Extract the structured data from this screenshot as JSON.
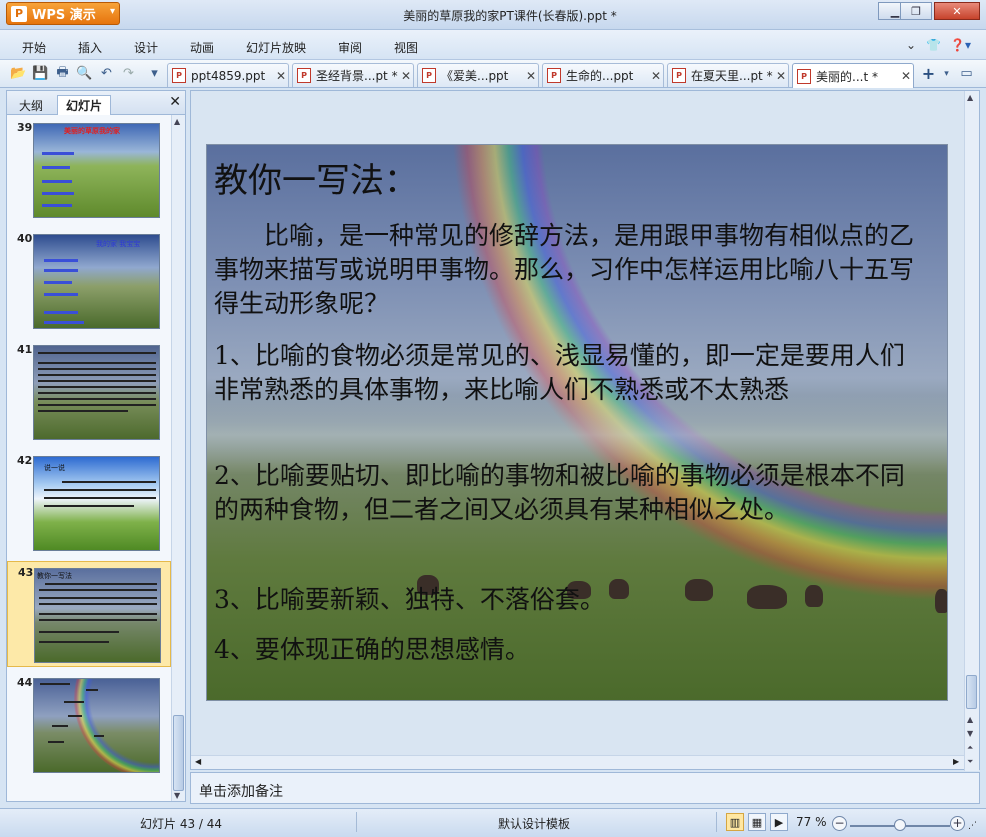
{
  "app": {
    "badge": "WPS 演示",
    "logo_letter": "P",
    "window_title": "美丽的草原我的家PT课件(长春版).ppt *"
  },
  "menu": {
    "items": [
      "开始",
      "插入",
      "设计",
      "动画",
      "幻灯片放映",
      "审阅",
      "视图"
    ]
  },
  "tabs": [
    {
      "label": "ppt4859.ppt",
      "active": false
    },
    {
      "label": "圣经背景...pt *",
      "active": false
    },
    {
      "label": "《爱美...ppt",
      "active": false
    },
    {
      "label": "生命的...ppt",
      "active": false
    },
    {
      "label": "在夏天里...pt *",
      "active": false
    },
    {
      "label": "美丽的...t *",
      "active": true
    }
  ],
  "left_panel": {
    "tab_outline": "大纲",
    "tab_slides": "幻灯片",
    "thumbnails": [
      {
        "num": "39",
        "title": "美丽的草原我的家"
      },
      {
        "num": "40",
        "title": "我的家 我宝宝"
      },
      {
        "num": "41",
        "title": ""
      },
      {
        "num": "42",
        "title": "说一说"
      },
      {
        "num": "43",
        "title": "教你一写法"
      },
      {
        "num": "44",
        "title": ""
      }
    ],
    "selected_index": 4
  },
  "slide": {
    "title": "教你一写法：",
    "intro": "　　比喻，是一种常见的修辞方法，是用跟甲事物有相似点的乙事物来描写或说明甲事物。那么，习作中怎样运用比喻八十五写得生动形象呢？",
    "point1": "1、比喻的食物必须是常见的、浅显易懂的，即一定是要用人们非常熟悉的具体事物，来比喻人们不熟悉或不太熟悉",
    "point2": "2、比喻要贴切、即比喻的事物和被比喻的事物必须是根本不同的两种食物，但二者之间又必须具有某种相似之处。",
    "point3": "3、比喻要新颖、独特、不落俗套。",
    "point4": "4、要体现正确的思想感情。"
  },
  "notes": {
    "placeholder": "单击添加备注"
  },
  "status": {
    "slide_counter": "幻灯片 43 / 44",
    "template": "默认设计模板",
    "zoom": "77 %",
    "zoom_fraction": 0.5
  }
}
